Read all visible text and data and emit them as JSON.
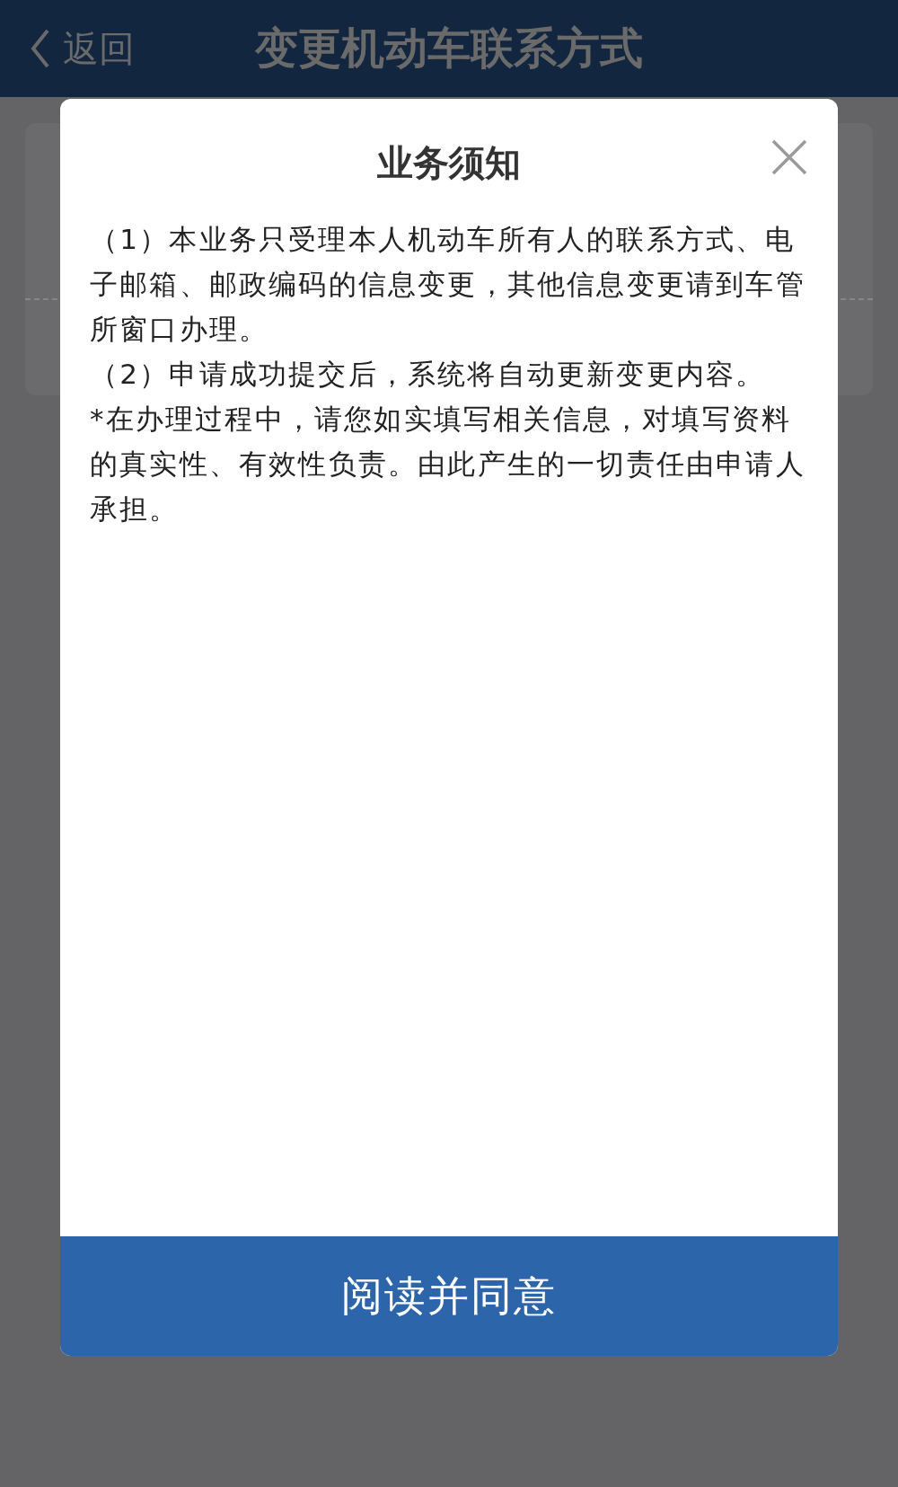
{
  "header": {
    "back": "返回",
    "title": "变更机动车联系方式"
  },
  "dialog": {
    "title": "业务须知",
    "paragraphs": [
      "（1）本业务只受理本人机动车所有人的联系方式、电子邮箱、邮政编码的信息变更，其他信息变更请到车管所窗口办理。",
      "（2）申请成功提交后，系统将自动更新变更内容。",
      "*在办理过程中，请您如实填写相关信息，对填写资料的真实性、有效性负责。由此产生的一切责任由申请人承担。"
    ],
    "button": "阅读并同意"
  }
}
